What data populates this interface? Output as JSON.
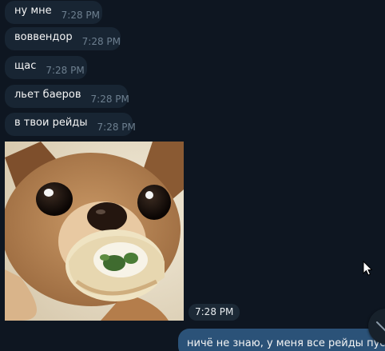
{
  "messages": [
    {
      "text": "ну мне",
      "time": "7:28 PM"
    },
    {
      "text": "воввендор",
      "time": "7:28 PM"
    },
    {
      "text": "щас",
      "time": "7:28 PM"
    },
    {
      "text": "льет баеров",
      "time": "7:28 PM"
    },
    {
      "text": "в твои рейды",
      "time": "7:28 PM"
    }
  ],
  "photo_message": {
    "time": "7:28 PM",
    "icon": "chihuahua-photo"
  },
  "outgoing": {
    "text": "ничё не знаю, у меня все рейды пустые"
  },
  "icons": {
    "scroll_down": "chevron-down-icon",
    "cursor": "mouse-pointer-icon"
  },
  "colors": {
    "background": "#0e1621",
    "incoming_bubble": "#182533",
    "outgoing_bubble": "#2b5278",
    "time_text": "#6d7f8f"
  }
}
